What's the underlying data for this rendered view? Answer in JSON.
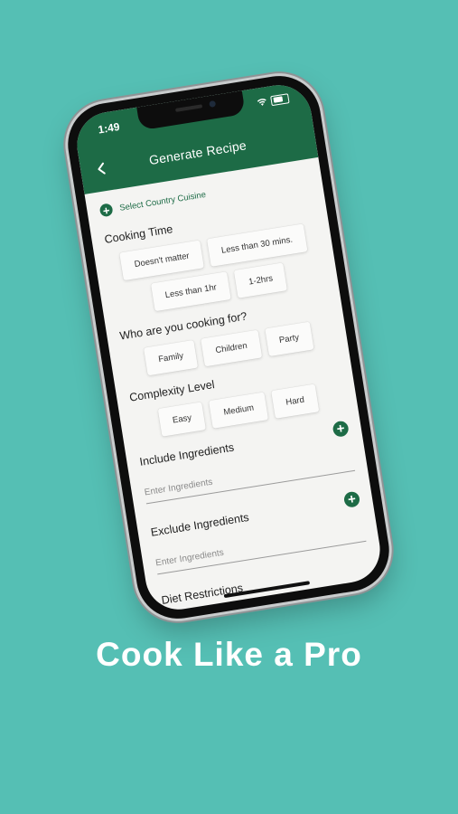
{
  "status_bar": {
    "time": "1:49"
  },
  "header": {
    "title": "Generate Recipe",
    "back_icon": "chevron-left-icon"
  },
  "country_cuisine": {
    "label": "Select Country Cuisine",
    "icon": "plus-circle-icon"
  },
  "cooking_time": {
    "title": "Cooking Time",
    "rows": [
      [
        "Doesn't matter",
        "Less than 30 mins."
      ],
      [
        "Less than 1hr",
        "1-2hrs"
      ]
    ]
  },
  "cooking_for": {
    "title": "Who are you cooking for?",
    "options": [
      "Family",
      "Children",
      "Party"
    ]
  },
  "complexity": {
    "title": "Complexity Level",
    "options": [
      "Easy",
      "Medium",
      "Hard"
    ]
  },
  "include_ingredients": {
    "title": "Include Ingredients",
    "placeholder": "Enter Ingredients"
  },
  "exclude_ingredients": {
    "title": "Exclude Ingredients",
    "placeholder": "Enter Ingredients"
  },
  "diet": {
    "title": "Diet Restrictions"
  },
  "tagline": "Cook Like a Pro",
  "colors": {
    "background": "#55bfb4",
    "brand_green": "#1d6b46",
    "screen_bg": "#f4f4f2"
  }
}
